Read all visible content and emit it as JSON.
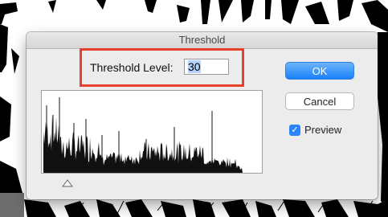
{
  "dialog": {
    "title": "Threshold",
    "threshold_label": "Threshold Level:",
    "threshold_value": "30",
    "ok_label": "OK",
    "cancel_label": "Cancel",
    "preview_label": "Preview",
    "preview_checked": true,
    "check_mark": "✓"
  },
  "colors": {
    "highlight_border": "#e8402a",
    "ok_button": "#1a82fb",
    "checkbox": "#2a86f8"
  },
  "icons": [
    "checkmark-icon",
    "slider-triangle-icon"
  ]
}
